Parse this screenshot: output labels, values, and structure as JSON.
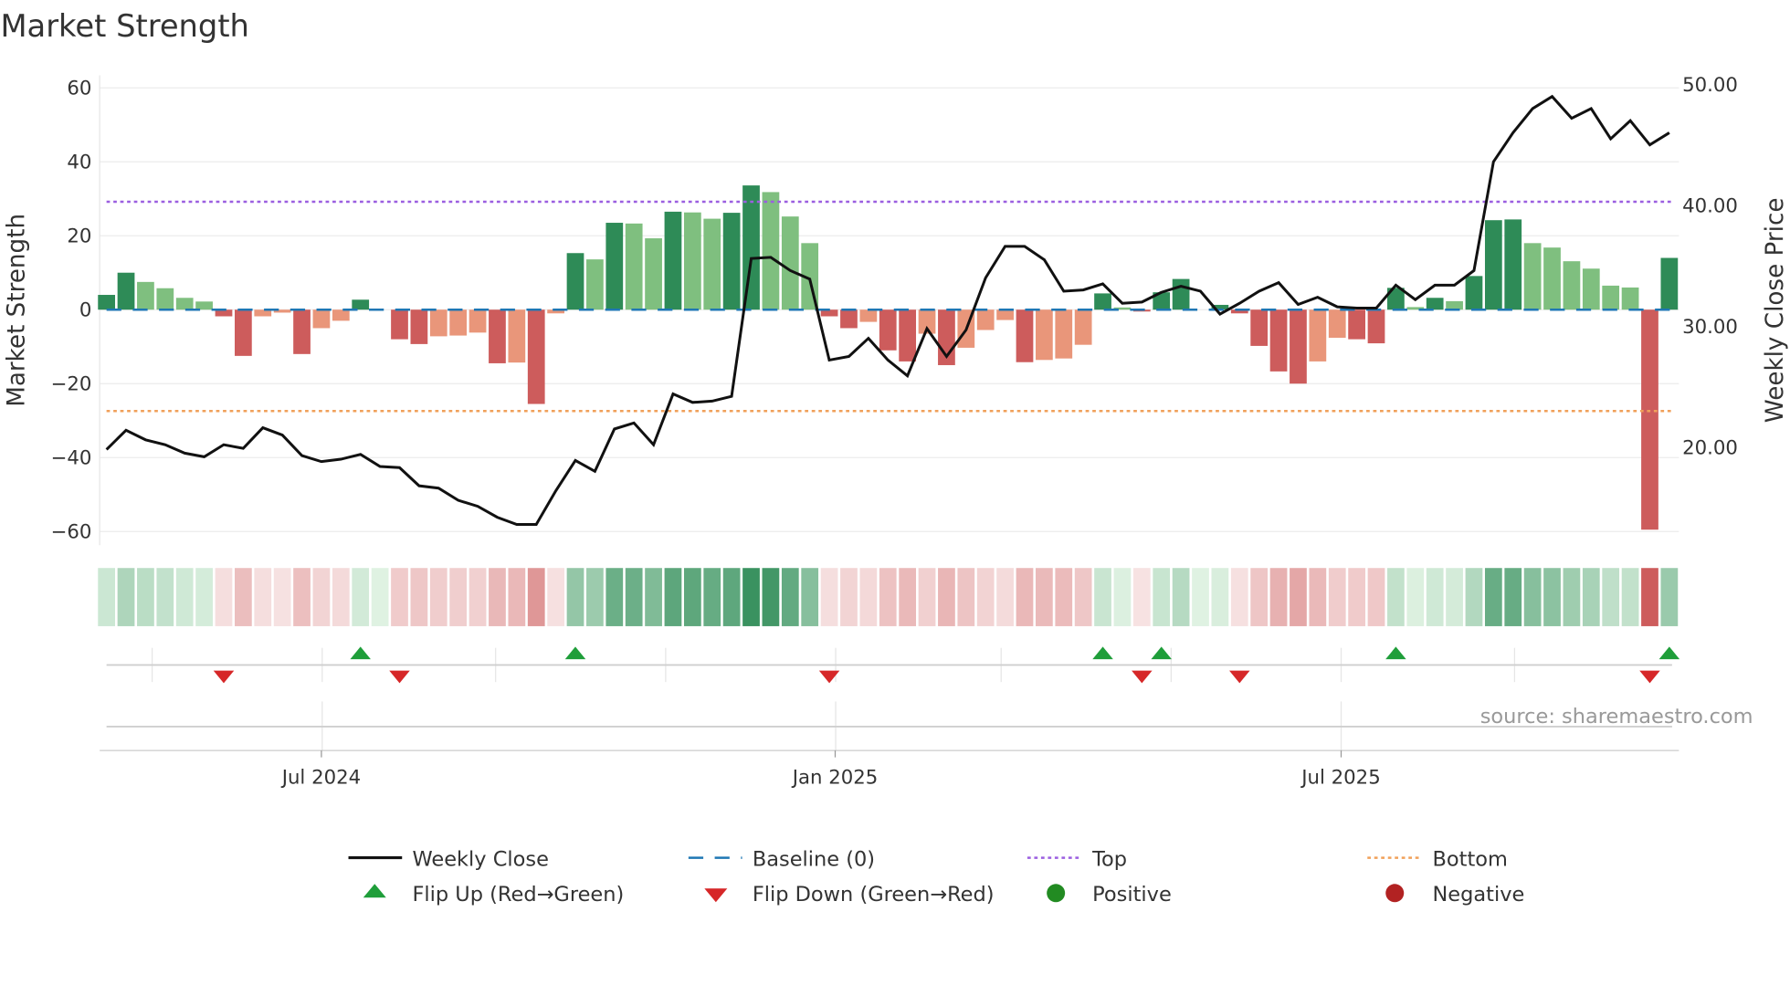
{
  "chart_data": {
    "type": "bar",
    "title": "Market Strength",
    "ylabel": "Market Strength",
    "y2label": "Weekly Close Price",
    "ylim": [
      -63,
      63
    ],
    "y2lim": [
      12.4,
      51.8
    ],
    "yticks": [
      "60",
      "40",
      "20",
      "0",
      "−20",
      "−40",
      "−60"
    ],
    "ytick_values": [
      60,
      40,
      20,
      0,
      -20,
      -40,
      -60
    ],
    "y2ticks": [
      "50.00",
      "40.00",
      "30.00",
      "20.00"
    ],
    "y2tick_values": [
      50,
      40,
      30,
      20
    ],
    "xticks": [
      "Jul 2024",
      "Jan 2025",
      "Jul 2025"
    ],
    "xtick_week_index": [
      11,
      37.3,
      63.2
    ],
    "top_level": 29.2,
    "bottom_level": -27.4,
    "baseline": 0,
    "strength": [
      4,
      10,
      7.5,
      5.8,
      3.2,
      2.2,
      -1.8,
      -12.5,
      -1.8,
      -0.8,
      -12,
      -5,
      -3,
      2.7,
      0,
      -8,
      -9.3,
      -7.2,
      -7,
      -6.2,
      -14.5,
      -14.3,
      -25.5,
      -1,
      15.3,
      13.6,
      23.5,
      23.3,
      19.3,
      26.5,
      26.3,
      24.6,
      26.2,
      33.6,
      31.8,
      25.2,
      18,
      -1.8,
      -5,
      -3.3,
      -11,
      -14,
      -6.5,
      -15,
      -10.3,
      -5.5,
      -2.8,
      -14.2,
      -13.6,
      -13.2,
      -9.5,
      4.4,
      0.6,
      -0.5,
      4.7,
      8.3,
      0,
      1.3,
      -1,
      -9.8,
      -16.7,
      -20,
      -14,
      -7.6,
      -8,
      -9.1,
      5.9,
      0.7,
      3.2,
      2.3,
      9.1,
      24.2,
      24.4,
      18,
      16.8,
      13.1,
      11.1,
      6.5,
      6,
      -59.5,
      14
    ],
    "weekly_close": [
      19.8,
      21.4,
      20.6,
      20.2,
      19.5,
      19.2,
      20.2,
      19.9,
      21.6,
      21.0,
      19.3,
      18.8,
      19.0,
      19.4,
      18.4,
      18.3,
      16.8,
      16.6,
      15.6,
      15.1,
      14.2,
      13.6,
      13.6,
      16.4,
      18.9,
      18.0,
      21.5,
      22.0,
      20.2,
      24.4,
      23.7,
      23.8,
      24.2,
      35.6,
      35.7,
      34.6,
      33.9,
      27.2,
      27.5,
      29.0,
      27.2,
      25.9,
      29.8,
      27.5,
      29.7,
      34.0,
      36.6,
      36.6,
      35.5,
      32.9,
      33.0,
      33.5,
      31.9,
      32.0,
      32.8,
      33.3,
      32.9,
      31.0,
      31.9,
      32.9,
      33.6,
      31.8,
      32.4,
      31.6,
      31.5,
      31.5,
      33.4,
      32.2,
      33.4,
      33.4,
      34.6,
      43.6,
      46.0,
      48.0,
      49.0,
      47.2,
      48.0,
      45.5,
      47.0,
      45.0,
      46.0
    ],
    "legend": {
      "weekly_close": "Weekly Close",
      "baseline": "Baseline (0)",
      "top": "Top",
      "bottom": "Bottom",
      "flip_up": "Flip Up (Red→Green)",
      "flip_down": "Flip Down (Green→Red)",
      "positive": "Positive",
      "negative": "Negative"
    },
    "legend_placement": "bottom",
    "grid": true
  },
  "source": "source: sharemaestro.com",
  "colors": {
    "strong_green": "#2e8b57",
    "weak_green": "#7fbf7f",
    "strong_red": "#cd5c5c",
    "weak_red": "#e9967a",
    "baseline": "#1f77b4",
    "top": "#9b5fe0",
    "bottom": "#f0a05a",
    "line": "#111111",
    "flip_up": "#1f9e3a",
    "flip_down": "#d62728",
    "positive": "#228b22",
    "negative": "#b22222"
  }
}
